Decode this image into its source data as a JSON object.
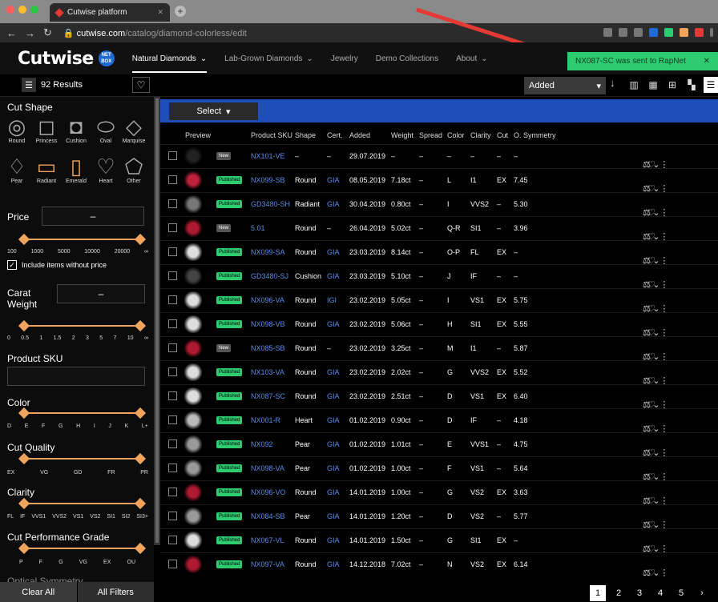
{
  "browser": {
    "tab_title": "Cutwise platform",
    "url_host": "cutwise.com",
    "url_path": "/catalog/diamond-colorless/edit"
  },
  "app": {
    "logo": "Cutwise",
    "logo_badge": "NET BOX",
    "nav": [
      "Natural Diamonds",
      "Lab-Grown Diamonds",
      "Jewelry",
      "Demo Collections",
      "About"
    ]
  },
  "toast": {
    "message": "NX087-SC was sent to RapNet",
    "close": "✕"
  },
  "toolbar": {
    "results": "92 Results",
    "sort_label": "Added",
    "sort_dir": "↓"
  },
  "sidebar": {
    "cut_shape_label": "Cut Shape",
    "shapes": [
      {
        "name": "Round",
        "glyph": "◎"
      },
      {
        "name": "Princess",
        "glyph": "◻"
      },
      {
        "name": "Cushion",
        "glyph": "◘"
      },
      {
        "name": "Oval",
        "glyph": "⬭"
      },
      {
        "name": "Marquise",
        "glyph": "◇"
      },
      {
        "name": "Pear",
        "glyph": "♢"
      },
      {
        "name": "Radiant",
        "glyph": "▭"
      },
      {
        "name": "Emerald",
        "glyph": "▯"
      },
      {
        "name": "Heart",
        "glyph": "♡"
      },
      {
        "name": "Other",
        "glyph": "⬠"
      }
    ],
    "price_label": "Price",
    "price_value": "–",
    "price_ticks": [
      "100",
      "1000",
      "5000",
      "10000",
      "20000",
      "∞"
    ],
    "include_label": "Include items without price",
    "carat_label": "Carat Weight",
    "carat_value": "–",
    "carat_ticks": [
      "0",
      "0.5",
      "1",
      "1.5",
      "2",
      "3",
      "5",
      "7",
      "10",
      "∞"
    ],
    "sku_label": "Product SKU",
    "color_label": "Color",
    "color_ticks": [
      "D",
      "E",
      "F",
      "G",
      "H",
      "I",
      "J",
      "K",
      "L+"
    ],
    "cut_quality_label": "Cut Quality",
    "cut_quality_ticks": [
      "EX",
      "VG",
      "GD",
      "FR",
      "PR"
    ],
    "clarity_label": "Clarity",
    "clarity_ticks": [
      "FL",
      "IF",
      "VVS1",
      "VVS2",
      "VS1",
      "VS2",
      "SI1",
      "SI2",
      "SI3+"
    ],
    "cpg_label": "Cut Performance Grade",
    "cpg_ticks": [
      "P",
      "F",
      "G",
      "VG",
      "EX",
      "OU"
    ],
    "next_label": "Optical Symmetry",
    "clear_all": "Clear All",
    "all_filters": "All Filters"
  },
  "table": {
    "select_label": "Select",
    "headers": [
      "Preview",
      "Product SKU",
      "Shape",
      "Cert.",
      "Added",
      "Weight",
      "Spread",
      "Color",
      "Clarity",
      "Cut",
      "O. Symmetry"
    ],
    "rows": [
      {
        "status": "New",
        "sku": "NX101-VE",
        "shape": "–",
        "cert": "–",
        "added": "29.07.2019",
        "weight": "–",
        "spread": "–",
        "color": "–",
        "clarity": "–",
        "cut": "–",
        "osym": "–",
        "thumb": "#222"
      },
      {
        "status": "Published",
        "sku": "NX099-SB",
        "shape": "Round",
        "cert": "GIA",
        "added": "08.05.2019",
        "weight": "7.18ct",
        "spread": "–",
        "color": "L",
        "clarity": "I1",
        "cut": "EX",
        "osym": "7.45",
        "thumb": "#c0203a"
      },
      {
        "status": "Published",
        "sku": "GD3480-SH",
        "shape": "Radiant",
        "cert": "GIA",
        "added": "30.04.2019",
        "weight": "0.80ct",
        "spread": "–",
        "color": "I",
        "clarity": "VVS2",
        "cut": "–",
        "osym": "5.30",
        "thumb": "#777"
      },
      {
        "status": "New",
        "sku": "5.01",
        "shape": "Round",
        "cert": "–",
        "added": "26.04.2019",
        "weight": "5.02ct",
        "spread": "–",
        "color": "Q-R",
        "clarity": "SI1",
        "cut": "–",
        "osym": "3.96",
        "thumb": "#b01a30"
      },
      {
        "status": "Published",
        "sku": "NX099-SA",
        "shape": "Round",
        "cert": "GIA",
        "added": "23.03.2019",
        "weight": "8.14ct",
        "spread": "–",
        "color": "O-P",
        "clarity": "FL",
        "cut": "EX",
        "osym": "–",
        "thumb": "#ddd"
      },
      {
        "status": "Published",
        "sku": "GD3480-SJ",
        "shape": "Cushion",
        "cert": "GIA",
        "added": "23.03.2019",
        "weight": "5.10ct",
        "spread": "–",
        "color": "J",
        "clarity": "IF",
        "cut": "–",
        "osym": "–",
        "thumb": "#444"
      },
      {
        "status": "Published",
        "sku": "NX096-VA",
        "shape": "Round",
        "cert": "IGI",
        "added": "23.02.2019",
        "weight": "5.05ct",
        "spread": "–",
        "color": "I",
        "clarity": "VS1",
        "cut": "EX",
        "osym": "5.75",
        "thumb": "#ddd"
      },
      {
        "status": "Published",
        "sku": "NX098-VB",
        "shape": "Round",
        "cert": "GIA",
        "added": "23.02.2019",
        "weight": "5.06ct",
        "spread": "–",
        "color": "H",
        "clarity": "SI1",
        "cut": "EX",
        "osym": "5.55",
        "thumb": "#ddd"
      },
      {
        "status": "New",
        "sku": "NX085-SB",
        "shape": "Round",
        "cert": "–",
        "added": "23.02.2019",
        "weight": "3.25ct",
        "spread": "–",
        "color": "M",
        "clarity": "I1",
        "cut": "–",
        "osym": "5.87",
        "thumb": "#b01a30"
      },
      {
        "status": "Published",
        "sku": "NX103-VA",
        "shape": "Round",
        "cert": "GIA",
        "added": "23.02.2019",
        "weight": "2.02ct",
        "spread": "–",
        "color": "G",
        "clarity": "VVS2",
        "cut": "EX",
        "osym": "5.52",
        "thumb": "#ddd"
      },
      {
        "status": "Published",
        "sku": "NX087-SC",
        "shape": "Round",
        "cert": "GIA",
        "added": "23.02.2019",
        "weight": "2.51ct",
        "spread": "–",
        "color": "D",
        "clarity": "VS1",
        "cut": "EX",
        "osym": "6.40",
        "thumb": "#ddd"
      },
      {
        "status": "Published",
        "sku": "NX001-R",
        "shape": "Heart",
        "cert": "GIA",
        "added": "01.02.2019",
        "weight": "0.90ct",
        "spread": "–",
        "color": "D",
        "clarity": "IF",
        "cut": "–",
        "osym": "4.18",
        "thumb": "#bbb"
      },
      {
        "status": "Published",
        "sku": "NX092",
        "shape": "Pear",
        "cert": "GIA",
        "added": "01.02.2019",
        "weight": "1.01ct",
        "spread": "–",
        "color": "E",
        "clarity": "VVS1",
        "cut": "–",
        "osym": "4.75",
        "thumb": "#999"
      },
      {
        "status": "Published",
        "sku": "NX098-VA",
        "shape": "Pear",
        "cert": "GIA",
        "added": "01.02.2019",
        "weight": "1.00ct",
        "spread": "–",
        "color": "F",
        "clarity": "VS1",
        "cut": "–",
        "osym": "5.64",
        "thumb": "#999"
      },
      {
        "status": "Published",
        "sku": "NX096-VO",
        "shape": "Round",
        "cert": "GIA",
        "added": "14.01.2019",
        "weight": "1.00ct",
        "spread": "–",
        "color": "G",
        "clarity": "VS2",
        "cut": "EX",
        "osym": "3.63",
        "thumb": "#b01a30"
      },
      {
        "status": "Published",
        "sku": "NX084-SB",
        "shape": "Pear",
        "cert": "GIA",
        "added": "14.01.2019",
        "weight": "1.20ct",
        "spread": "–",
        "color": "D",
        "clarity": "VS2",
        "cut": "–",
        "osym": "5.77",
        "thumb": "#999"
      },
      {
        "status": "Published",
        "sku": "NX067-VL",
        "shape": "Round",
        "cert": "GIA",
        "added": "14.01.2019",
        "weight": "1.50ct",
        "spread": "–",
        "color": "G",
        "clarity": "SI1",
        "cut": "EX",
        "osym": "–",
        "thumb": "#ddd"
      },
      {
        "status": "Published",
        "sku": "NX097-VA",
        "shape": "Round",
        "cert": "GIA",
        "added": "14.12.2018",
        "weight": "7.02ct",
        "spread": "–",
        "color": "N",
        "clarity": "VS2",
        "cut": "EX",
        "osym": "6.14",
        "thumb": "#b01a30"
      }
    ]
  },
  "pager": [
    "1",
    "2",
    "3",
    "4",
    "5",
    "›"
  ]
}
